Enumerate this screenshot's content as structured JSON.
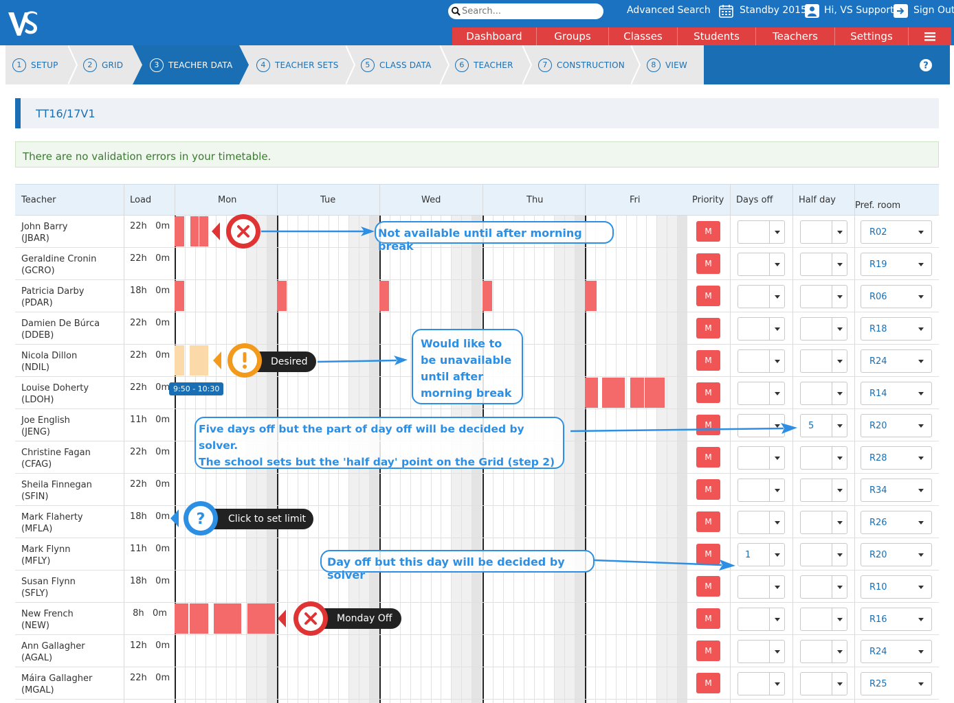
{
  "header": {
    "logo_text": "VS",
    "search_placeholder": "Search...",
    "advanced_search": "Advanced Search",
    "standby": "Standby 2015",
    "user": "Hi, VS Support",
    "signout": "Sign Out",
    "accent": "#1a72c0"
  },
  "topnav": [
    "Dashboard",
    "Groups",
    "Classes",
    "Students",
    "Teachers",
    "Settings"
  ],
  "steps": [
    {
      "num": "1",
      "label": "SETUP"
    },
    {
      "num": "2",
      "label": "GRID"
    },
    {
      "num": "3",
      "label": "TEACHER DATA"
    },
    {
      "num": "4",
      "label": "TEACHER SETS"
    },
    {
      "num": "5",
      "label": "CLASS DATA"
    },
    {
      "num": "6",
      "label": "TEACHER"
    },
    {
      "num": "7",
      "label": "CONSTRUCTION"
    },
    {
      "num": "8",
      "label": "VIEW"
    }
  ],
  "active_step": 2,
  "page_title": "TT16/17V1",
  "validation_message": "There are no validation errors in your timetable.",
  "table": {
    "headers": {
      "teacher": "Teacher",
      "load": "Load",
      "days": [
        "Mon",
        "Tue",
        "Wed",
        "Thu",
        "Fri"
      ],
      "priority": "Priority",
      "days_off": "Days off",
      "half_day": "Half day",
      "pref_room": "Pref. room"
    },
    "rows": [
      {
        "name": "John Barry",
        "code": "(JBAR)",
        "load": "22h   0m",
        "priority": "M",
        "days_off": "",
        "half_day": "",
        "room": "R02"
      },
      {
        "name": "Geraldine Cronin",
        "code": "(GCRO)",
        "load": "22h   0m",
        "priority": "M",
        "days_off": "",
        "half_day": "",
        "room": "R19"
      },
      {
        "name": "Patricia Darby",
        "code": "(PDAR)",
        "load": "18h   0m",
        "priority": "M",
        "days_off": "",
        "half_day": "",
        "room": "R06"
      },
      {
        "name": "Damien De Búrca",
        "code": "(DDEB)",
        "load": "22h   0m",
        "priority": "M",
        "days_off": "",
        "half_day": "",
        "room": "R18"
      },
      {
        "name": "Nicola Dillon",
        "code": "(NDIL)",
        "load": "22h   0m",
        "priority": "M",
        "days_off": "",
        "half_day": "",
        "room": "R24"
      },
      {
        "name": "Louise Doherty",
        "code": "(LDOH)",
        "load": "22h   0m",
        "priority": "M",
        "days_off": "",
        "half_day": "",
        "room": "R14"
      },
      {
        "name": "Joe English",
        "code": "(JENG)",
        "load": "11h   0m",
        "priority": "M",
        "days_off": "",
        "half_day": "5",
        "room": "R20"
      },
      {
        "name": "Christine Fagan",
        "code": "(CFAG)",
        "load": "22h   0m",
        "priority": "M",
        "days_off": "",
        "half_day": "",
        "room": "R28"
      },
      {
        "name": "Sheila Finnegan",
        "code": "(SFIN)",
        "load": "22h   0m",
        "priority": "M",
        "days_off": "",
        "half_day": "",
        "room": "R34"
      },
      {
        "name": "Mark Flaherty",
        "code": "(MFLA)",
        "load": "18h   0m",
        "priority": "M",
        "days_off": "",
        "half_day": "",
        "room": "R26"
      },
      {
        "name": "Mark Flynn",
        "code": "(MFLY)",
        "load": "11h   0m",
        "priority": "M",
        "days_off": "1",
        "half_day": "",
        "room": "R20"
      },
      {
        "name": "Susan Flynn",
        "code": "(SFLY)",
        "load": "18h   0m",
        "priority": "M",
        "days_off": "",
        "half_day": "",
        "room": "R10"
      },
      {
        "name": "New French",
        "code": "(NEW)",
        "load": " 8h   0m",
        "priority": "M",
        "days_off": "",
        "half_day": "",
        "room": "R16"
      },
      {
        "name": "Ann Gallagher",
        "code": "(AGAL)",
        "load": "12h   0m",
        "priority": "M",
        "days_off": "",
        "half_day": "",
        "room": "R24"
      },
      {
        "name": "Máira Gallagher",
        "code": "(MGAL)",
        "load": "22h   0m",
        "priority": "M",
        "days_off": "",
        "half_day": "",
        "room": "R25"
      }
    ]
  },
  "annotations": {
    "not_available": "Not available until after morning break",
    "desired": "Desired",
    "would_like": [
      "Would like to",
      "be unavailable",
      "until after",
      "morning break"
    ],
    "time_tooltip": "9:50 - 10:30",
    "five_days": [
      "Five days off but the part of day off will be decided by solver.",
      "The school sets but the 'half day' point on the Grid (step 2)"
    ],
    "click_limit": "Click to set limit",
    "day_off": "Day off but this day will be decided by solver",
    "monday_off": "Monday Off"
  },
  "colors": {
    "unavailable": "#f46a6a",
    "desired": "#fbd9a8",
    "priority_button": "#f05454",
    "annotation_blue": "#2c8fe3"
  }
}
